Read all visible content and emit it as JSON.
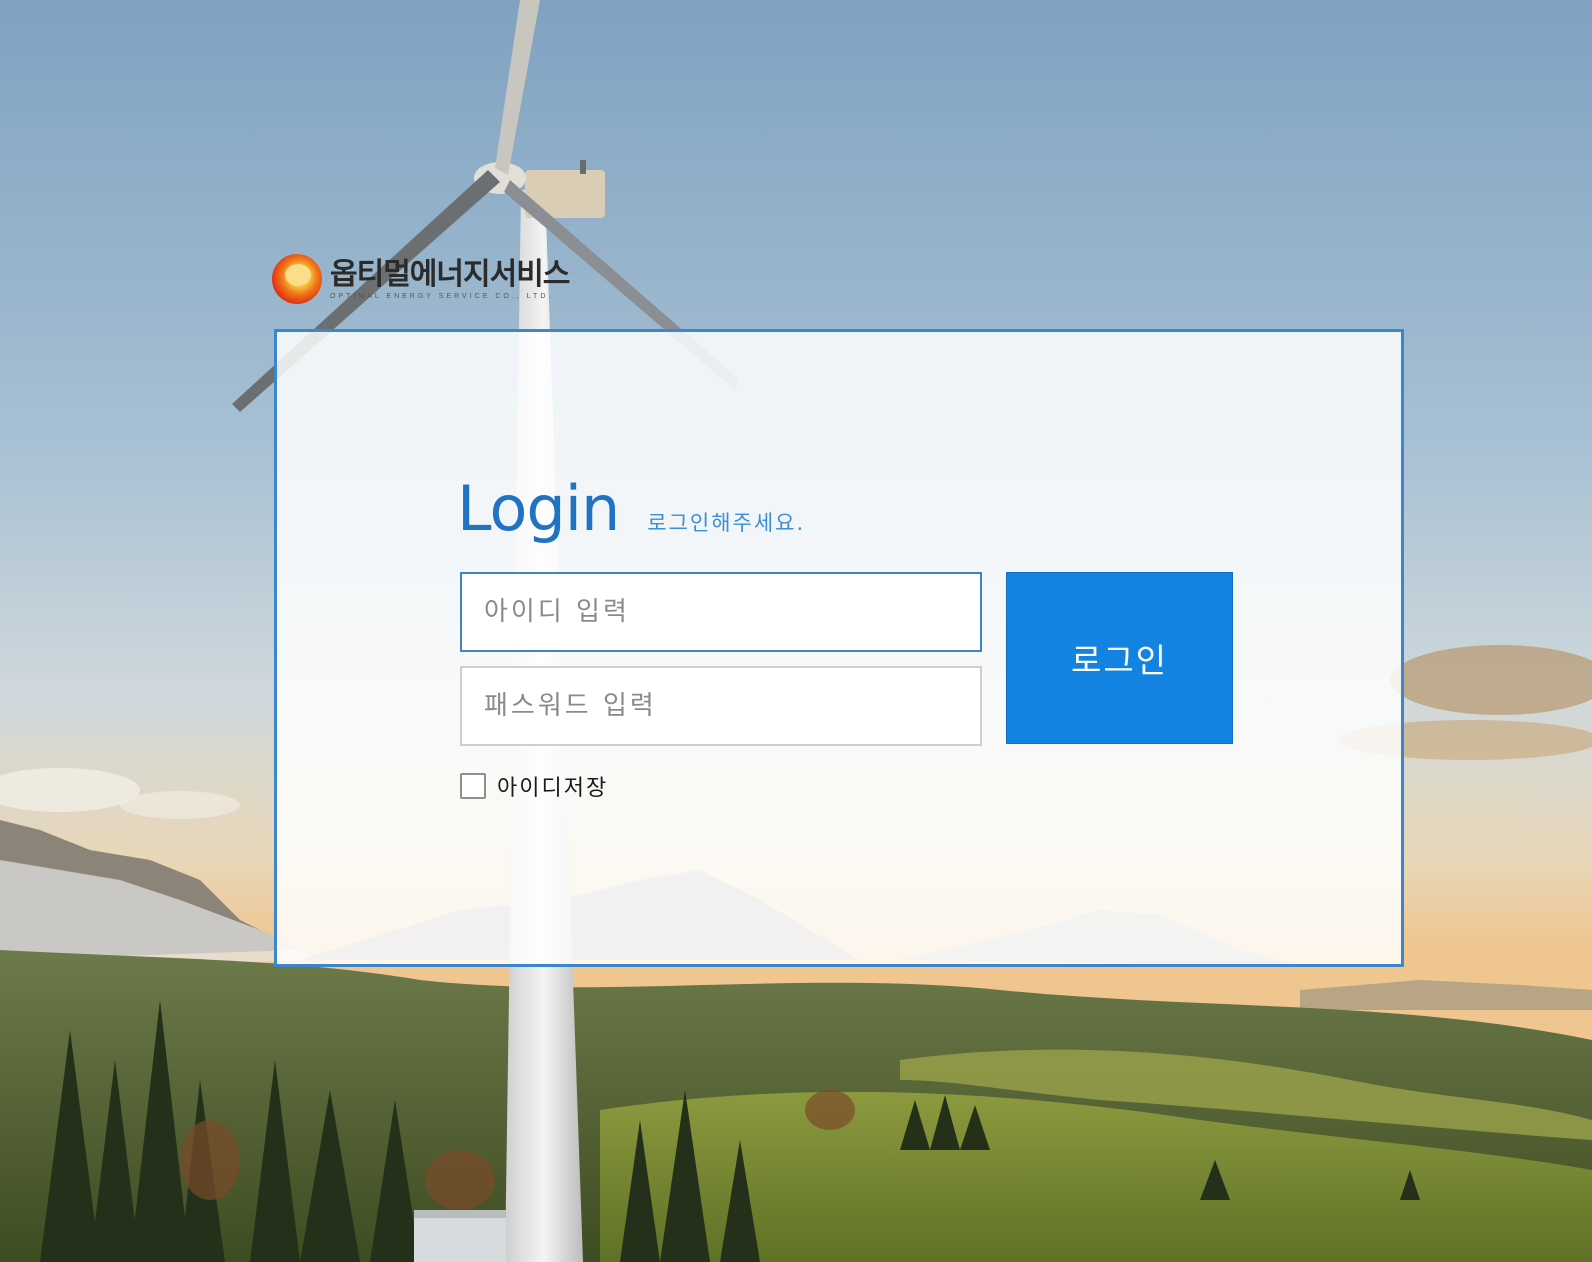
{
  "logo": {
    "name": "옵티멀에너지서비스",
    "subtitle": "OPTIMAL ENERGY SERVICE CO., LTD."
  },
  "login": {
    "title": "Login",
    "subtitle": "로그인해주세요.",
    "id_placeholder": "아이디 입력",
    "password_placeholder": "패스워드 입력",
    "button_label": "로그인",
    "remember_label": "아이디저장",
    "remember_checked": false
  },
  "colors": {
    "accent": "#1283e1",
    "panel_border": "#3d86cc",
    "title": "#1f73c2"
  },
  "background": {
    "description_icon": "wind-turbine-landscape-image"
  }
}
